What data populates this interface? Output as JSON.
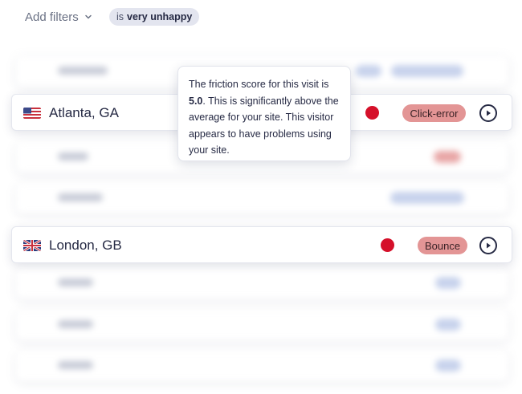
{
  "filters": {
    "add_label": "Add filters",
    "active_chip": {
      "prefix": "is",
      "value": "very unhappy"
    }
  },
  "visits": [
    {
      "location": "Atlanta, GA",
      "flag": "us-flag-icon",
      "tag": "Click-error",
      "status_color": "#d5102a"
    },
    {
      "location": "London, GB",
      "flag": "uk-flag-icon",
      "tag": "Bounce",
      "status_color": "#d5102a"
    }
  ],
  "tooltip": {
    "line1": "The friction score for this visit is",
    "score": "5.0",
    "line2": ". This is significantly above the average for your site. This visitor appears to have problems using your site."
  },
  "colors": {
    "accent_red": "#d5102a",
    "tag_bg": "#e39595",
    "chip_bg": "#e3e5ef"
  }
}
